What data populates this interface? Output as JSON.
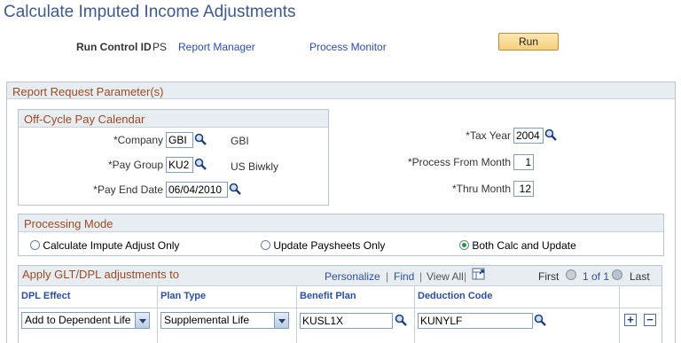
{
  "page": {
    "title": "Calculate Imputed Income Adjustments"
  },
  "run_control": {
    "label": "Run Control ID",
    "value": "PS",
    "report_manager": "Report Manager",
    "process_monitor": "Process Monitor",
    "run_button": "Run"
  },
  "report_params": {
    "header": "Report Request Parameter(s)"
  },
  "offcycle": {
    "header": "Off-Cycle Pay Calendar",
    "company_label": "*Company",
    "company_value": "GBI",
    "company_desc": "GBI",
    "paygroup_label": "*Pay Group",
    "paygroup_value": "KU2",
    "paygroup_desc": "US Biwkly",
    "payend_label": "*Pay End Date",
    "payend_value": "06/04/2010"
  },
  "tax": {
    "taxyear_label": "*Tax Year",
    "taxyear_value": "2004",
    "from_label": "*Process From Month",
    "from_value": "1",
    "thru_label": "*Thru Month",
    "thru_value": "12"
  },
  "processing": {
    "header": "Processing Mode",
    "options": [
      {
        "label": "Calculate Impute Adjust Only",
        "selected": false
      },
      {
        "label": "Update Paysheets Only",
        "selected": false
      },
      {
        "label": "Both Calc and Update",
        "selected": true
      }
    ]
  },
  "grid": {
    "header": "Apply GLT/DPL adjustments to",
    "personalize": "Personalize",
    "find": "Find",
    "sep1": "|",
    "view_all": "View All",
    "sep2": "|",
    "first": "First",
    "page_info": "1 of 1",
    "last": "Last",
    "columns": [
      "DPL Effect",
      "Plan Type",
      "Benefit Plan",
      "Deduction Code"
    ],
    "row": {
      "dpl_effect": "Add to Dependent Life",
      "plan_type": "Supplemental Life",
      "benefit_plan": "KUSL1X",
      "deduction_code": "KUNYLF"
    },
    "add_symbol": "+",
    "remove_symbol": "−"
  },
  "icons": {
    "lookup": "magnifier-lookup-icon",
    "download": "download-grid-icon",
    "nav_prev": "previous-arrow-icon",
    "nav_next": "next-arrow-icon"
  },
  "colors": {
    "title": "#3d5a8a",
    "section_header": "#9c4a26",
    "link": "#2b4f9c",
    "run_button": "#f5cf7c"
  }
}
